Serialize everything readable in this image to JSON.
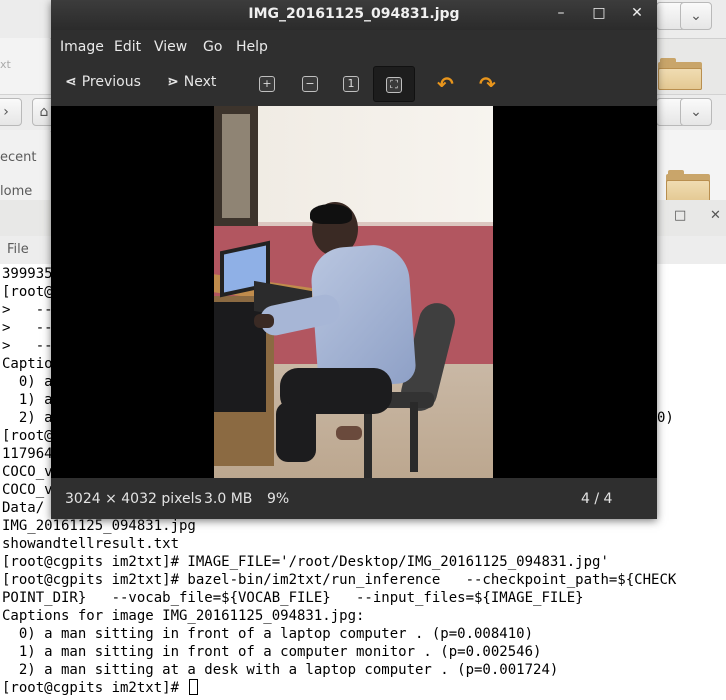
{
  "background": {
    "sidebar_items": [
      "ecent",
      "lome"
    ],
    "address_fragment": "xt"
  },
  "terminal": {
    "menu": [
      "File"
    ],
    "lines": [
      "399935",
      "[root@",
      ">   --",
      ">   --",
      ">   --",
      "Captio",
      "  0) a",
      "  1) a",
      "  2) a",
      "[root@",
      "117964",
      "COCO_v",
      "COCO_v",
      "Data/",
      "IMG_20161125_094831.jpg",
      "showandtellresult.txt",
      "[root@cgpits im2txt]# IMAGE_FILE='/root/Desktop/IMG_20161125_094831.jpg'",
      "[root@cgpits im2txt]# bazel-bin/im2txt/run_inference   --checkpoint_path=${CHECK",
      "POINT_DIR}   --vocab_file=${VOCAB_FILE}   --input_files=${IMAGE_FILE}",
      "Captions for image IMG_20161125_094831.jpg:",
      "  0) a man sitting in front of a laptop computer . (p=0.008410)",
      "  1) a man sitting in front of a computer monitor . (p=0.002546)",
      "  2) a man sitting at a desk with a laptop computer . (p=0.001724)",
      "[root@cgpits im2txt]# "
    ],
    "partial_right": "0)"
  },
  "viewer": {
    "title": "IMG_20161125_094831.jpg",
    "window_buttons": {
      "minimize": "–",
      "maximize": "□",
      "close": "✕"
    },
    "menu": [
      "Image",
      "Edit",
      "View",
      "Go",
      "Help"
    ],
    "toolbar": {
      "previous_label": "Previous",
      "next_label": "Next"
    },
    "status": {
      "dimensions": "3024 × 4032 pixels",
      "size": "3.0 MB",
      "zoom": "9%",
      "position": "4 / 4"
    }
  }
}
